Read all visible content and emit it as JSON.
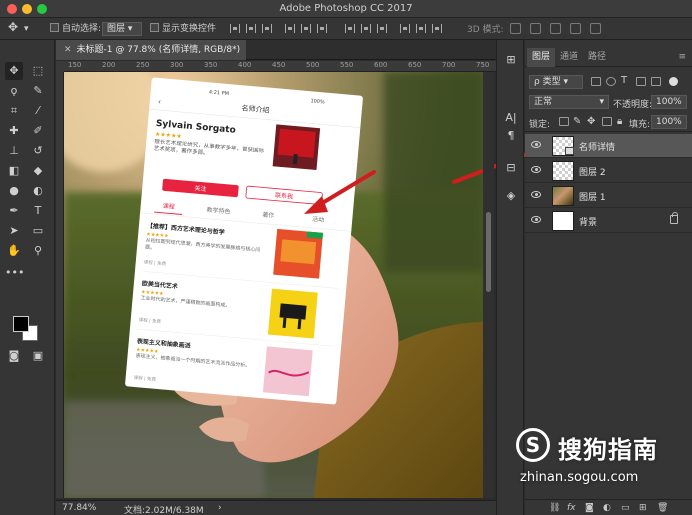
{
  "window": {
    "title": "Adobe Photoshop CC 2017"
  },
  "options_bar": {
    "auto_select_label": "自动选择:",
    "auto_select_value": "图层",
    "show_transform_label": "显示变换控件",
    "mode_3d_label": "3D 模式:"
  },
  "document": {
    "tab_title": "未标题-1 @ 77.8% (名师详情, RGB/8*) *",
    "ruler_ticks": [
      "150",
      "200",
      "250",
      "300",
      "350",
      "400",
      "450",
      "500",
      "550",
      "600",
      "650",
      "700",
      "750"
    ]
  },
  "status_bar": {
    "zoom": "77.84%",
    "doc_size": "文档:2.02M/6.38M"
  },
  "layers_panel": {
    "tabs": [
      "图层",
      "通道",
      "路径"
    ],
    "filter_label": "ρ 类型",
    "blend_mode": "正常",
    "opacity_label": "不透明度:",
    "opacity_value": "100%",
    "lock_label": "锁定:",
    "fill_label": "填充:",
    "fill_value": "100%",
    "layers": [
      {
        "name": "名师详情",
        "thumb": "checker",
        "selected": true,
        "smart_object": true,
        "locked": false
      },
      {
        "name": "图层 2",
        "thumb": "checker",
        "selected": false,
        "smart_object": false,
        "locked": false
      },
      {
        "name": "图层 1",
        "thumb": "photo",
        "selected": false,
        "smart_object": false,
        "locked": false
      },
      {
        "name": "背景",
        "thumb": "white",
        "selected": false,
        "smart_object": false,
        "locked": true
      }
    ],
    "footer_icons": [
      "link-icon",
      "fx-icon",
      "mask-icon",
      "adjustment-icon",
      "folder-icon",
      "new-layer-icon",
      "trash-icon"
    ],
    "footer_fx": "fx"
  },
  "phone_screen": {
    "status_time": "4:21 PM",
    "status_battery": "100%",
    "nav_title": "名师介绍",
    "teacher_name": "Sylvain Sorgato",
    "teacher_bio": "擅长艺术理论研究，从事教学多年，曾获国际艺术奖项，著作多部。",
    "follow_button": "关注",
    "message_button": "联系我",
    "tabs": [
      "课程",
      "教学特色",
      "著作",
      "活动"
    ],
    "courses": [
      {
        "title": "【推荐】西方艺术理论与哲学",
        "desc": "从柏拉图到现代思潮，西方美学的发展脉络与核心问题。",
        "meta": "课程 | 免费"
      },
      {
        "title": "欧美当代艺术",
        "desc": "工业时代的艺术，严谨精致的画面构成。",
        "meta": "课程 | 免费"
      },
      {
        "title": "表现主义和抽象画派",
        "desc": "表现主义，抽象画派一个时期的艺术流派作品分析。",
        "meta": "课程 | 免费"
      }
    ]
  },
  "watermark": {
    "logo_letter": "S",
    "name": "搜狗指南",
    "url": "zhinan.sogou.com"
  },
  "colors": {
    "accent_red": "#e8233f",
    "arrow_red": "#d01e1e",
    "panel_bg": "#353535",
    "selected_layer": "#575757"
  }
}
